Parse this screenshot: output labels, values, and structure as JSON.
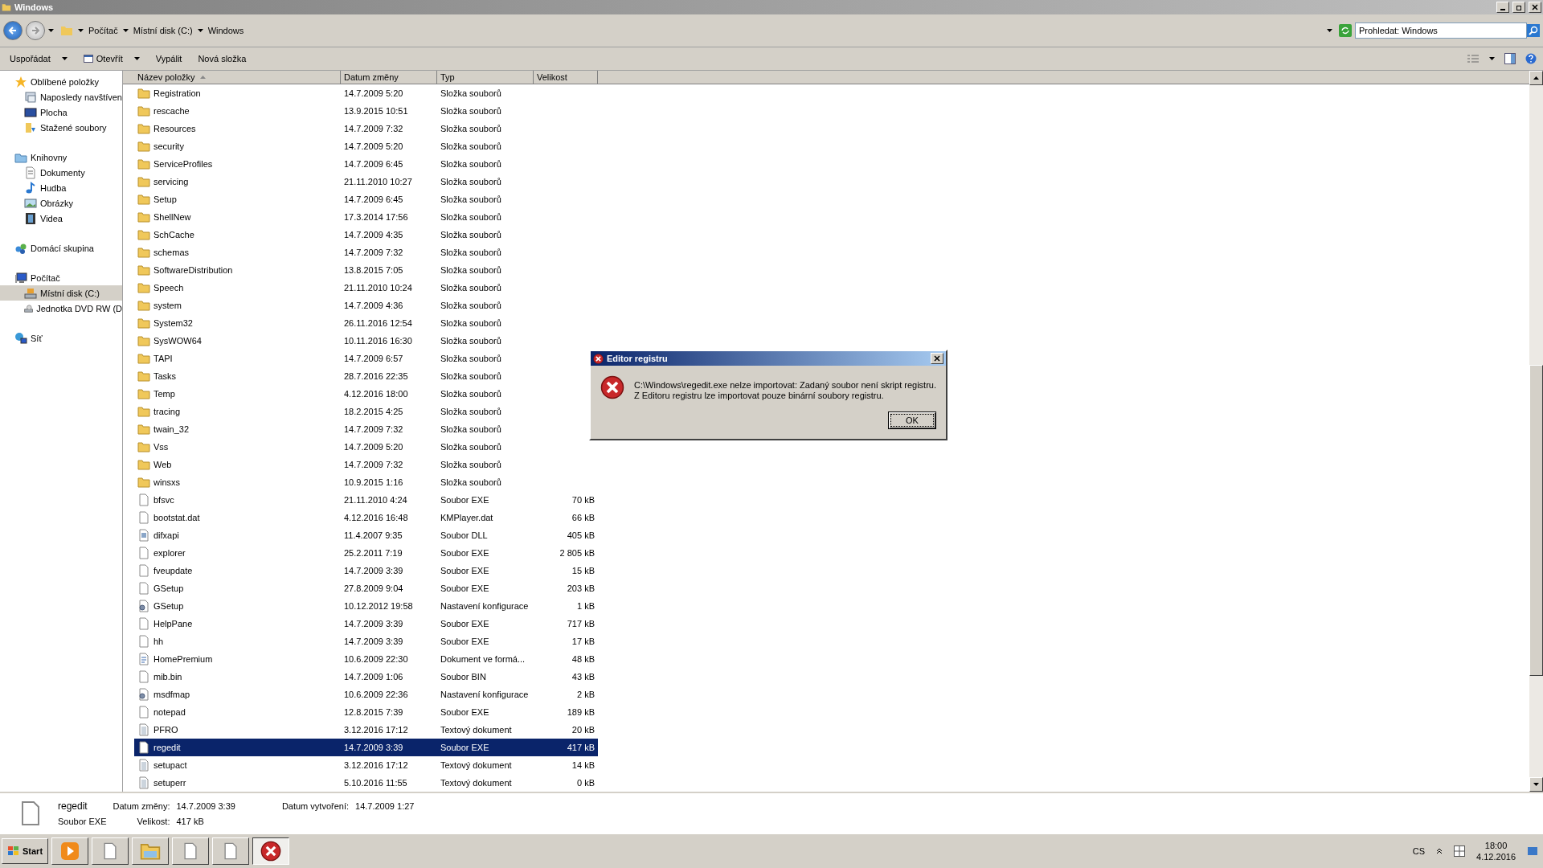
{
  "window": {
    "title": "Windows"
  },
  "address": {
    "breadcrumbs": [
      "Počítač",
      "Místní disk (C:)",
      "Windows"
    ]
  },
  "search": {
    "placeholder": "Prohledat: Windows"
  },
  "toolbar": [
    {
      "label": "Uspořádat",
      "kind": "menu"
    },
    {
      "label": "Otevřít",
      "kind": "split"
    },
    {
      "label": "Vypálit",
      "kind": "plain"
    },
    {
      "label": "Nová složka",
      "kind": "plain"
    }
  ],
  "sidebar": [
    {
      "label": "Oblíbené položky",
      "kind": "star",
      "selected": false,
      "children": [
        {
          "label": "Naposledy navštíven",
          "kind": "recent",
          "selected": false
        },
        {
          "label": "Plocha",
          "kind": "desktop",
          "selected": false
        },
        {
          "label": "Stažené soubory",
          "kind": "downloads",
          "selected": false
        }
      ]
    },
    {
      "label": "Knihovny",
      "kind": "library",
      "selected": false,
      "children": [
        {
          "label": "Dokumenty",
          "kind": "document",
          "selected": false
        },
        {
          "label": "Hudba",
          "kind": "music",
          "selected": false
        },
        {
          "label": "Obrázky",
          "kind": "pictures",
          "selected": false
        },
        {
          "label": "Videa",
          "kind": "videos",
          "selected": false
        }
      ]
    },
    {
      "label": "Domácí skupina",
      "kind": "homegroup",
      "selected": false
    },
    {
      "label": "Počítač",
      "kind": "computer",
      "selected": false,
      "children": [
        {
          "label": "Místní disk (C:)",
          "kind": "disk",
          "selected": true
        },
        {
          "label": "Jednotka DVD RW (D",
          "kind": "dvd",
          "selected": false
        }
      ]
    },
    {
      "label": "Síť",
      "kind": "network",
      "selected": false
    }
  ],
  "table": {
    "columns": [
      {
        "label": "Název položky",
        "sorted": true
      },
      {
        "label": "Datum změny",
        "sorted": false
      },
      {
        "label": "Typ",
        "sorted": false
      },
      {
        "label": "Velikost",
        "sorted": false
      }
    ],
    "rows": [
      {
        "name": "Registration",
        "date": "14.7.2009 5:20",
        "type": "Složka souborů",
        "kind": "folder",
        "selected": false
      },
      {
        "name": "rescache",
        "date": "13.9.2015 10:51",
        "type": "Složka souborů",
        "kind": "folder",
        "selected": false
      },
      {
        "name": "Resources",
        "date": "14.7.2009 7:32",
        "type": "Složka souborů",
        "kind": "folder",
        "selected": false
      },
      {
        "name": "security",
        "date": "14.7.2009 5:20",
        "type": "Složka souborů",
        "kind": "folder",
        "selected": false
      },
      {
        "name": "ServiceProfiles",
        "date": "14.7.2009 6:45",
        "type": "Složka souborů",
        "kind": "folder",
        "selected": false
      },
      {
        "name": "servicing",
        "date": "21.11.2010 10:27",
        "type": "Složka souborů",
        "kind": "folder",
        "selected": false
      },
      {
        "name": "Setup",
        "date": "14.7.2009 6:45",
        "type": "Složka souborů",
        "kind": "folder",
        "selected": false
      },
      {
        "name": "ShellNew",
        "date": "17.3.2014 17:56",
        "type": "Složka souborů",
        "kind": "folder",
        "selected": false
      },
      {
        "name": "SchCache",
        "date": "14.7.2009 4:35",
        "type": "Složka souborů",
        "kind": "folder",
        "selected": false
      },
      {
        "name": "schemas",
        "date": "14.7.2009 7:32",
        "type": "Složka souborů",
        "kind": "folder",
        "selected": false
      },
      {
        "name": "SoftwareDistribution",
        "date": "13.8.2015 7:05",
        "type": "Složka souborů",
        "kind": "folder",
        "selected": false
      },
      {
        "name": "Speech",
        "date": "21.11.2010 10:24",
        "type": "Složka souborů",
        "kind": "folder",
        "selected": false
      },
      {
        "name": "system",
        "date": "14.7.2009 4:36",
        "type": "Složka souborů",
        "kind": "folder",
        "selected": false
      },
      {
        "name": "System32",
        "date": "26.11.2016 12:54",
        "type": "Složka souborů",
        "kind": "folder",
        "selected": false
      },
      {
        "name": "SysWOW64",
        "date": "10.11.2016 16:30",
        "type": "Složka souborů",
        "kind": "folder",
        "selected": false
      },
      {
        "name": "TAPI",
        "date": "14.7.2009 6:57",
        "type": "Složka souborů",
        "kind": "folder",
        "selected": false
      },
      {
        "name": "Tasks",
        "date": "28.7.2016 22:35",
        "type": "Složka souborů",
        "kind": "folder",
        "selected": false
      },
      {
        "name": "Temp",
        "date": "4.12.2016 18:00",
        "type": "Složka souborů",
        "kind": "folder",
        "selected": false
      },
      {
        "name": "tracing",
        "date": "18.2.2015 4:25",
        "type": "Složka souborů",
        "kind": "folder",
        "selected": false
      },
      {
        "name": "twain_32",
        "date": "14.7.2009 7:32",
        "type": "Složka souborů",
        "kind": "folder",
        "selected": false
      },
      {
        "name": "Vss",
        "date": "14.7.2009 5:20",
        "type": "Složka souborů",
        "kind": "folder",
        "selected": false
      },
      {
        "name": "Web",
        "date": "14.7.2009 7:32",
        "type": "Složka souborů",
        "kind": "folder",
        "selected": false
      },
      {
        "name": "winsxs",
        "date": "10.9.2015 1:16",
        "type": "Složka souborů",
        "kind": "folder",
        "selected": false
      },
      {
        "name": "bfsvc",
        "date": "21.11.2010 4:24",
        "type": "Soubor EXE",
        "size": "70 kB",
        "kind": "file",
        "selected": false
      },
      {
        "name": "bootstat.dat",
        "date": "4.12.2016 16:48",
        "type": "KMPlayer.dat",
        "size": "66 kB",
        "kind": "file",
        "selected": false
      },
      {
        "name": "difxapi",
        "date": "11.4.2007 9:35",
        "type": "Soubor DLL",
        "size": "405 kB",
        "kind": "dll",
        "selected": false
      },
      {
        "name": "explorer",
        "date": "25.2.2011 7:19",
        "type": "Soubor EXE",
        "size": "2 805 kB",
        "kind": "file",
        "selected": false
      },
      {
        "name": "fveupdate",
        "date": "14.7.2009 3:39",
        "type": "Soubor EXE",
        "size": "15 kB",
        "kind": "file",
        "selected": false
      },
      {
        "name": "GSetup",
        "date": "27.8.2009 9:04",
        "type": "Soubor EXE",
        "size": "203 kB",
        "kind": "file",
        "selected": false
      },
      {
        "name": "GSetup",
        "date": "10.12.2012 19:58",
        "type": "Nastavení konfigurace",
        "size": "1 kB",
        "kind": "config",
        "selected": false
      },
      {
        "name": "HelpPane",
        "date": "14.7.2009 3:39",
        "type": "Soubor EXE",
        "size": "717 kB",
        "kind": "file",
        "selected": false
      },
      {
        "name": "hh",
        "date": "14.7.2009 3:39",
        "type": "Soubor EXE",
        "size": "17 kB",
        "kind": "file",
        "selected": false
      },
      {
        "name": "HomePremium",
        "date": "10.6.2009 22:30",
        "type": "Dokument ve formá...",
        "size": "48 kB",
        "kind": "doc",
        "selected": false
      },
      {
        "name": "mib.bin",
        "date": "14.7.2009 1:06",
        "type": "Soubor BIN",
        "size": "43 kB",
        "kind": "file",
        "selected": false
      },
      {
        "name": "msdfmap",
        "date": "10.6.2009 22:36",
        "type": "Nastavení konfigurace",
        "size": "2 kB",
        "kind": "config",
        "selected": false
      },
      {
        "name": "notepad",
        "date": "12.8.2015 7:39",
        "type": "Soubor EXE",
        "size": "189 kB",
        "kind": "file",
        "selected": false
      },
      {
        "name": "PFRO",
        "date": "3.12.2016 17:12",
        "type": "Textový dokument",
        "size": "20 kB",
        "kind": "text",
        "selected": false
      },
      {
        "name": "regedit",
        "date": "14.7.2009 3:39",
        "type": "Soubor EXE",
        "size": "417 kB",
        "kind": "file",
        "selected": true
      },
      {
        "name": "setupact",
        "date": "3.12.2016 17:12",
        "type": "Textový dokument",
        "size": "14 kB",
        "kind": "text",
        "selected": false
      },
      {
        "name": "setuperr",
        "date": "5.10.2016 11:55",
        "type": "Textový dokument",
        "size": "0 kB",
        "kind": "text",
        "selected": false
      }
    ]
  },
  "details": {
    "name": "regedit",
    "type": "Soubor EXE",
    "kind": "file",
    "fields": [
      {
        "label": "Datum změny:",
        "value": "14.7.2009 3:39"
      },
      {
        "label": "Velikost:",
        "value": "417 kB"
      },
      {
        "label": "Datum vytvoření:",
        "value": "14.7.2009 1:27"
      }
    ]
  },
  "dialog": {
    "title": "Editor registru",
    "lines": [
      "C:\\Windows\\regedit.exe nelze importovat: Zadaný soubor není skript registru.",
      "Z Editoru registru lze importovat pouze binární soubory registru."
    ],
    "button": "OK"
  },
  "taskbar": {
    "start": "Start",
    "tasks": [
      {
        "kind": "media",
        "selected": false
      },
      {
        "kind": "document",
        "selected": false
      },
      {
        "kind": "explorer",
        "selected": false
      },
      {
        "kind": "document",
        "selected": false
      },
      {
        "kind": "document",
        "selected": false
      },
      {
        "kind": "error",
        "selected": true
      }
    ],
    "language": "CS",
    "time": "18:00",
    "date": "4.12.2016"
  }
}
